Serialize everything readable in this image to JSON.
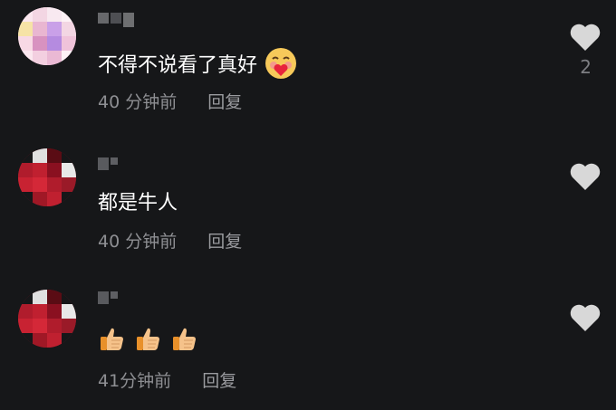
{
  "comments": [
    {
      "text": "不得不说看了真好",
      "emoji": "smiling-face-with-heart-emoji",
      "time": "40 分钟前",
      "reply_label": "回复",
      "likes": "2",
      "avatar_colors": [
        "#f3d6e3",
        "#e9b6d1",
        "#c9a0e8",
        "#f6e3a6",
        "#ffffff"
      ]
    },
    {
      "text": "都是牛人",
      "time": "40 分钟前",
      "reply_label": "回复",
      "likes": "",
      "avatar_colors": [
        "#c02030",
        "#8a1020",
        "#e0e0e0",
        "#5a0c14",
        "#ffffff"
      ]
    },
    {
      "text": "",
      "emoji": "thumbs-up-emoji x3",
      "time": "41分钟前",
      "reply_label": "回复",
      "likes": "",
      "avatar_colors": [
        "#c02030",
        "#8a1020",
        "#e0e0e0",
        "#5a0c14",
        "#ffffff"
      ]
    }
  ],
  "colors": {
    "background": "#161719",
    "text": "#ffffff",
    "meta": "#8e8f93",
    "like_icon": "#d8d8d8"
  }
}
